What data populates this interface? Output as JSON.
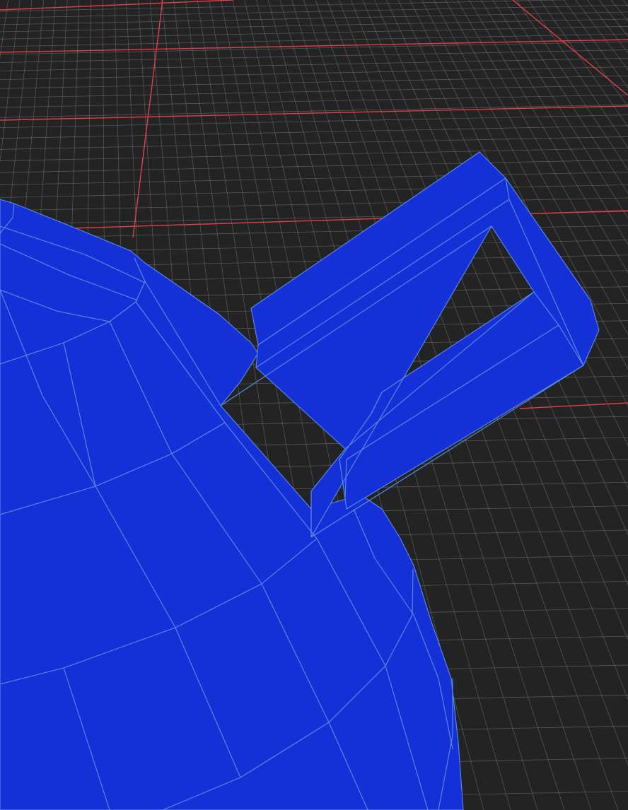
{
  "viewport": {
    "background_color": "#232323",
    "grid_minor_color": "#8a8a8a",
    "grid_major_color": "#e0404a",
    "mesh_fill_color": "#1630d8",
    "mesh_wire_color": "#5a8ee6",
    "mesh_object": "teapot-wireframe"
  }
}
